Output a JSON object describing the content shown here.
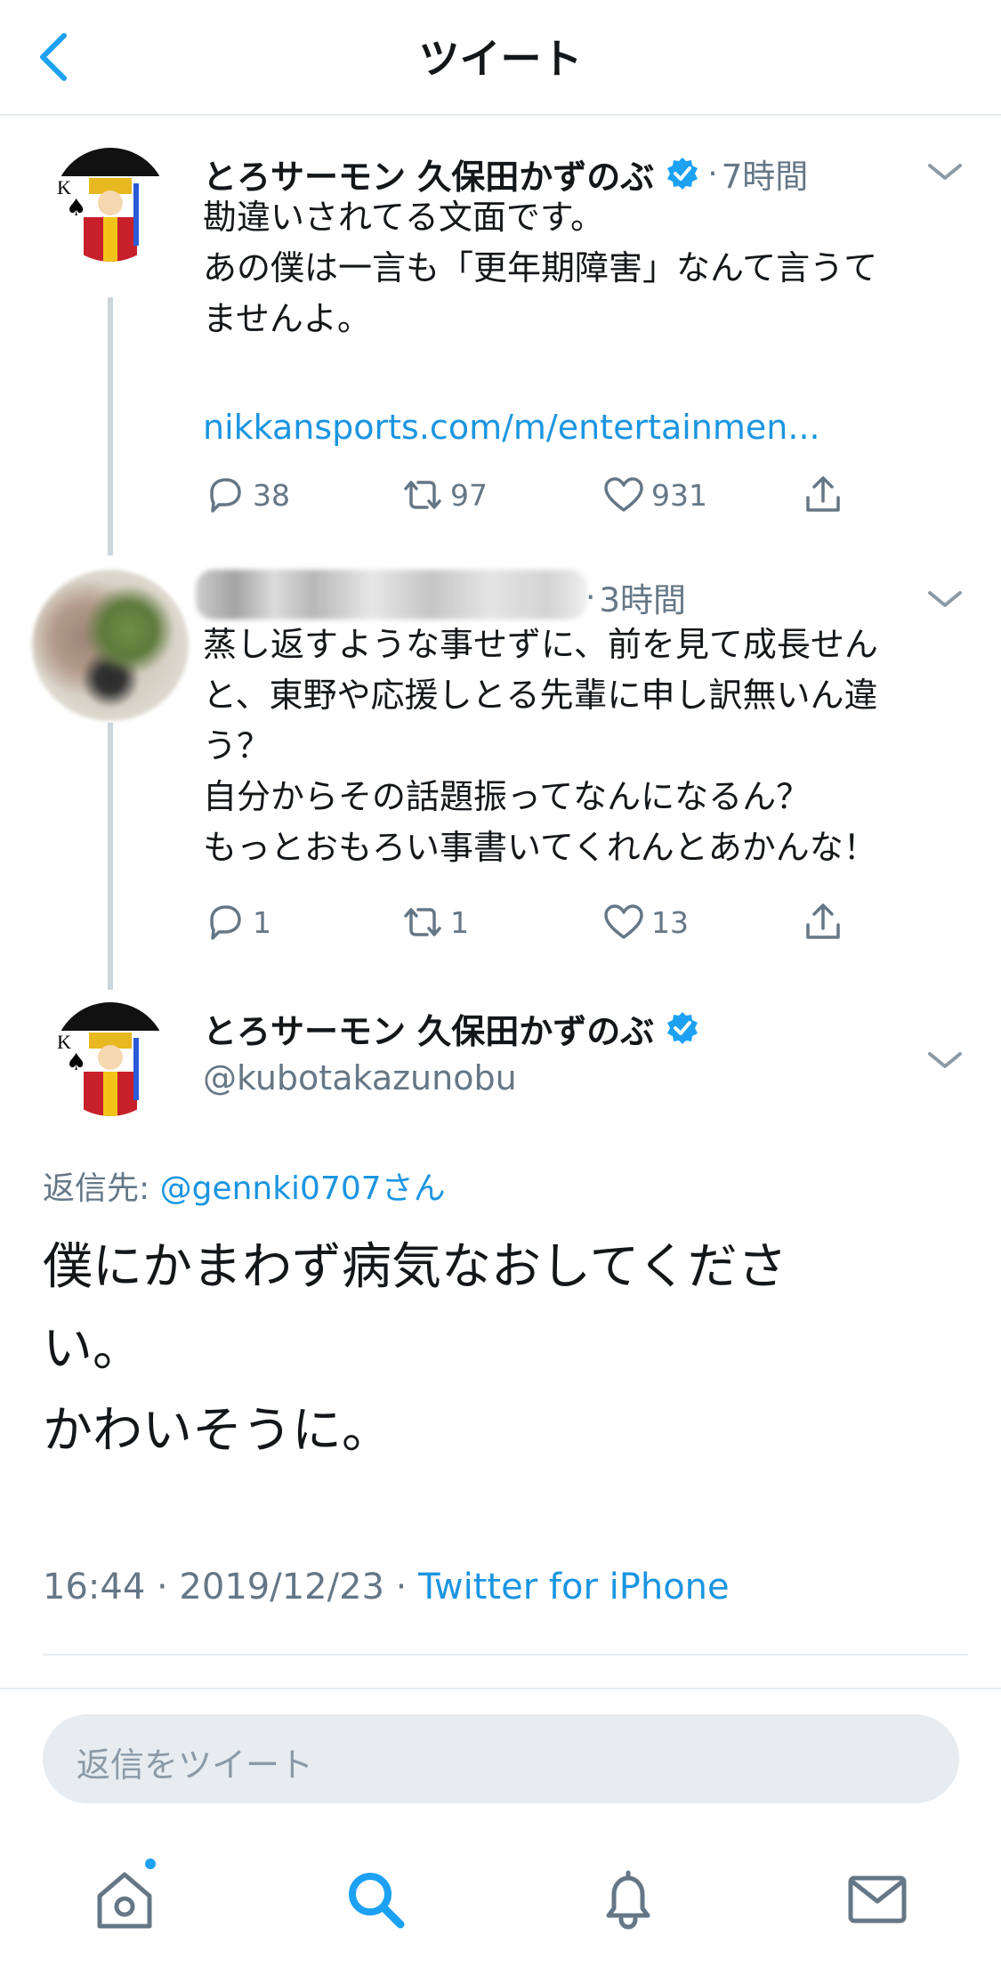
{
  "header": {
    "title": "ツイート",
    "back_icon": "chevron-left-icon"
  },
  "thread": [
    {
      "name": "とろサーモン 久保田かずのぶ",
      "verified": true,
      "separator": "·",
      "time": "7時間",
      "text_lines": "勘違いされてる文面です。\nあの僕は一言も「更年期障害」なんて言うて\nませんよ。",
      "link": "nikkansports.com/m/entertainmen...",
      "counts": {
        "replies": "38",
        "retweets": "97",
        "likes": "931"
      }
    },
    {
      "separator": "·",
      "time": "3時間",
      "text_lines": "蒸し返すような事せずに、前を見て成長せん\nと、東野や応援しとる先輩に申し訳無いん違\nう？\n自分からその話題振ってなんになるん？\nもっとおもろい事書いてくれんとあかんな！",
      "counts": {
        "replies": "1",
        "retweets": "1",
        "likes": "13"
      }
    }
  ],
  "main_tweet": {
    "name": "とろサーモン 久保田かずのぶ",
    "verified": true,
    "handle": "@kubotakazunobu",
    "reply_label": "返信先: ",
    "reply_to": "@gennki0707さん",
    "text": "僕にかまわず病気なおしてくださ\nい。\nかわいそうに。",
    "timestamp": "16:44 · 2019/12/23 · ",
    "source": "Twitter for iPhone"
  },
  "reply_input": {
    "placeholder": "返信をツイート"
  },
  "colors": {
    "accent": "#1da1f2",
    "link": "#1b95e0",
    "secondary_text": "#657786",
    "line": "#ccd6dd"
  },
  "tabbar": {
    "items": [
      "home-icon",
      "search-icon",
      "notifications-icon",
      "messages-icon"
    ],
    "home_has_badge": true
  }
}
